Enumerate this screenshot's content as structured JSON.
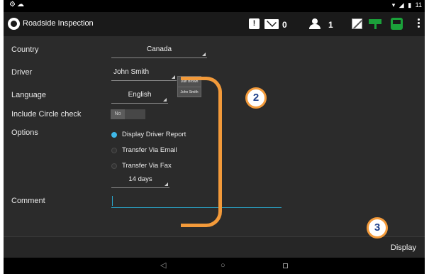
{
  "status_bar": {
    "left_icons": [
      "settings-icon",
      "cloud-icon"
    ],
    "time_partial": "11"
  },
  "action_bar": {
    "title": "Roadside Inspection",
    "mail_count": "0",
    "user_count": "1"
  },
  "form": {
    "country": {
      "label": "Country",
      "value": "Canada"
    },
    "driver": {
      "label": "Driver",
      "value": "John Smith",
      "options": [
        "Dan Brown",
        "John Smith"
      ]
    },
    "language": {
      "label": "Language",
      "value": "English"
    },
    "circle_check": {
      "label": "Include Circle check",
      "toggle_text": "No"
    },
    "options": {
      "label": "Options",
      "items": [
        {
          "text": "Display Driver Report",
          "checked": true
        },
        {
          "text": "Transfer Via Email",
          "checked": false
        },
        {
          "text": "Transfer Via Fax",
          "checked": false
        }
      ],
      "period": "14 days"
    },
    "comment": {
      "label": "Comment",
      "value": ""
    }
  },
  "callouts": [
    "2",
    "3"
  ],
  "footer": {
    "display_label": "Display"
  },
  "colors": {
    "accent": "#3fb8e8",
    "annotation": "#f39a3a",
    "status_green": "#1ba13a"
  }
}
